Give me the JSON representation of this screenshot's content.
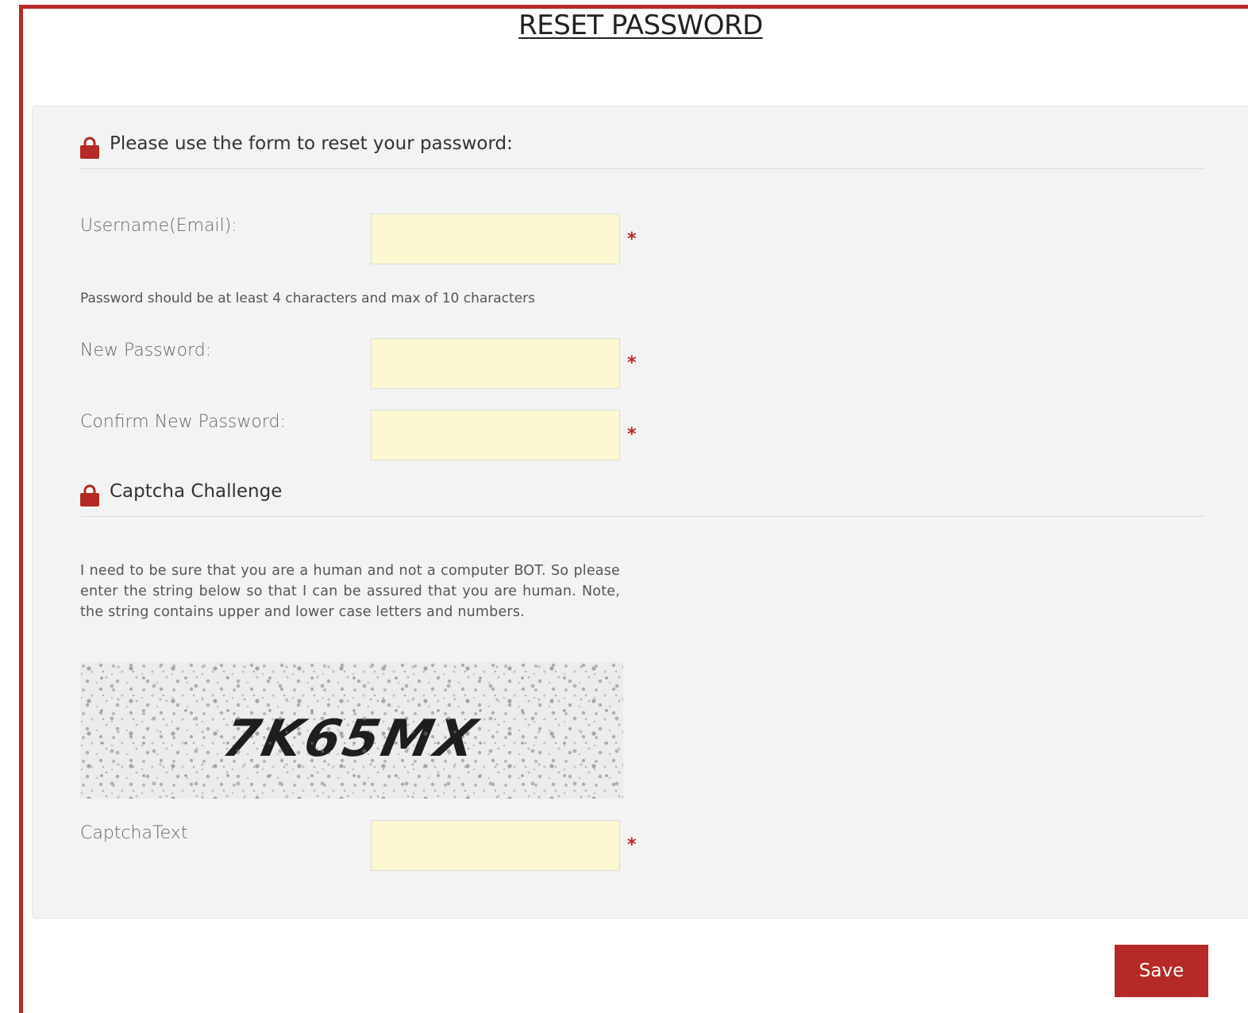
{
  "page": {
    "title": "RESET PASSWORD"
  },
  "form_section": {
    "header": "Please use the form to reset your password:",
    "icon": "lock-icon"
  },
  "fields": {
    "username": {
      "label": "Username(Email):",
      "value": "",
      "required_mark": "*"
    },
    "password_hint": "Password should be at least 4 characters and max of 10 characters",
    "new_password": {
      "label": "New Password:",
      "value": "",
      "required_mark": "*"
    },
    "confirm_password": {
      "label": "Confirm New Password:",
      "value": "",
      "required_mark": "*"
    }
  },
  "captcha_section": {
    "header": "Captcha Challenge",
    "icon": "lock-icon",
    "description": "I need to be sure that you are a human and not a computer BOT. So please enter the string below so that I can be assured that you are human. Note, the string contains upper and lower case letters and numbers.",
    "image_text": "7K65MX",
    "captcha_text": {
      "label": "CaptchaText",
      "value": "",
      "required_mark": "*"
    }
  },
  "actions": {
    "save_label": "Save"
  },
  "colors": {
    "accent": "#b52a26",
    "input_bg": "#fbf8d2",
    "panel_bg": "#f3f3f3"
  }
}
